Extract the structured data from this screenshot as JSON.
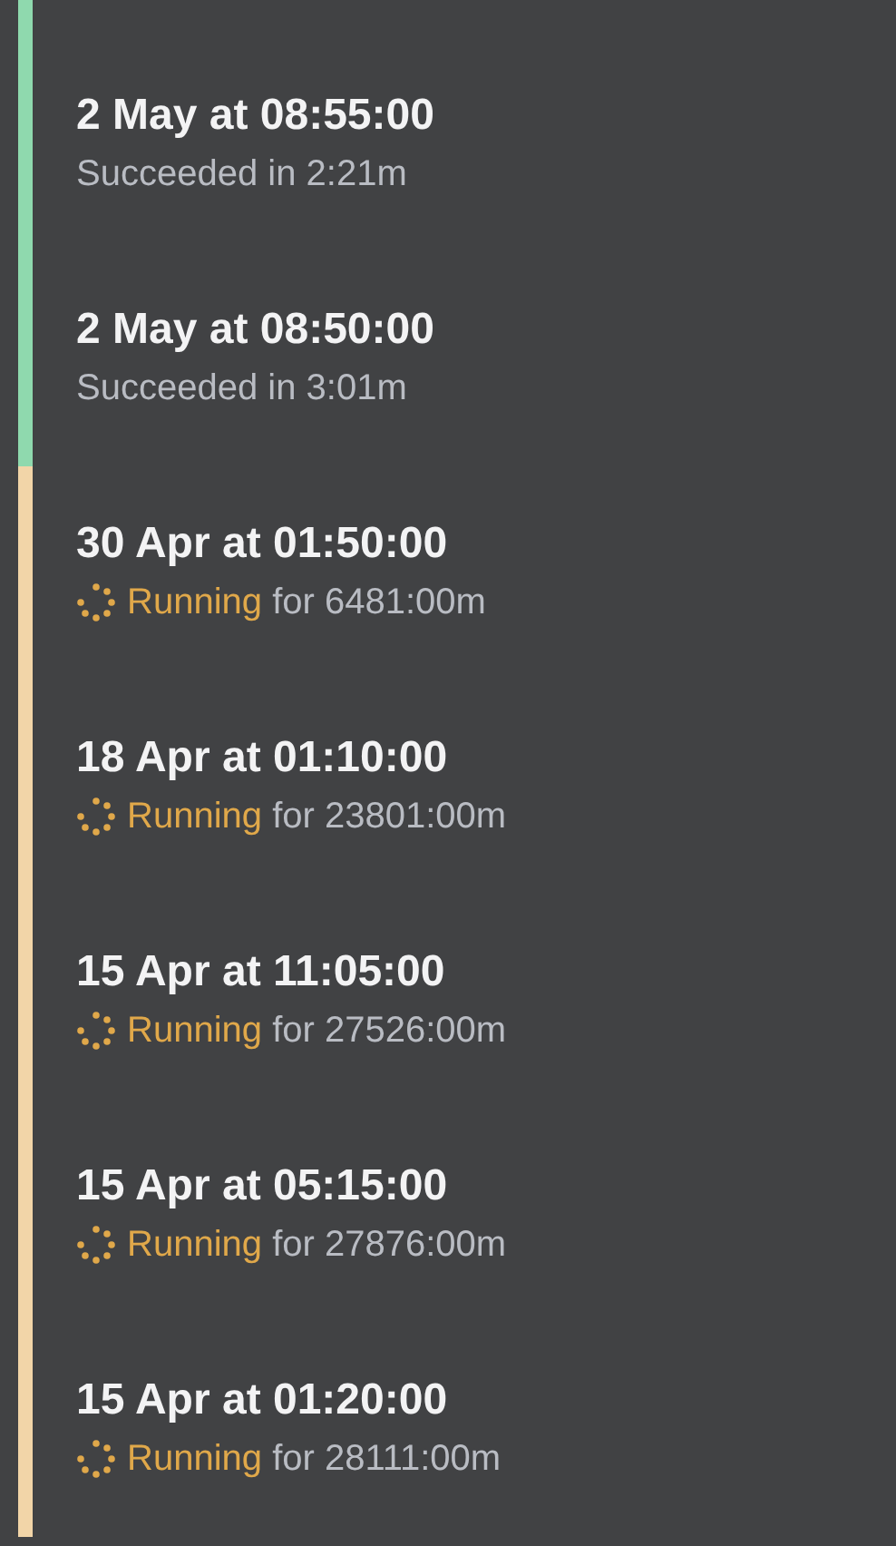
{
  "runs": [
    {
      "kind": "succeeded",
      "title": "2 May at 08:55:00",
      "status": "Succeeded",
      "detail": "in 2:21m"
    },
    {
      "kind": "succeeded",
      "title": "2 May at 08:50:00",
      "status": "Succeeded",
      "detail": "in 3:01m"
    },
    {
      "kind": "running",
      "title": "30 Apr at 01:50:00",
      "status": "Running",
      "detail": "for 6481:00m"
    },
    {
      "kind": "running",
      "title": "18 Apr at 01:10:00",
      "status": "Running",
      "detail": "for 23801:00m"
    },
    {
      "kind": "running",
      "title": "15 Apr at 11:05:00",
      "status": "Running",
      "detail": "for 27526:00m"
    },
    {
      "kind": "running",
      "title": "15 Apr at 05:15:00",
      "status": "Running",
      "detail": "for 27876:00m"
    },
    {
      "kind": "running",
      "title": "15 Apr at 01:20:00",
      "status": "Running",
      "detail": "for 28111:00m"
    }
  ]
}
